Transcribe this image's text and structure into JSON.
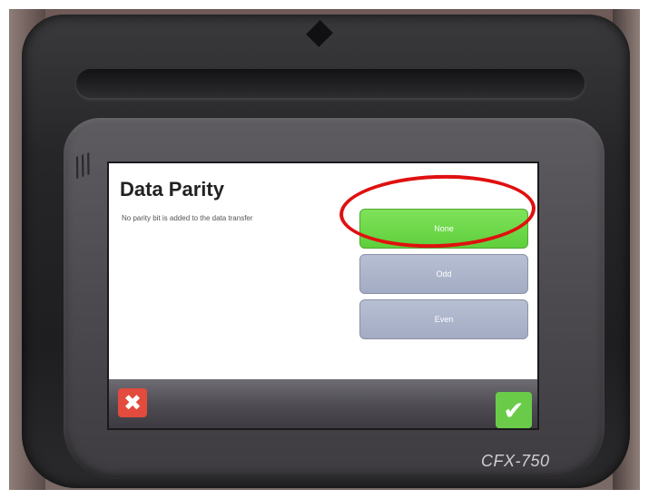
{
  "screen": {
    "title": "Data Parity",
    "description": "No parity bit is added to the data transfer",
    "options": [
      {
        "label": "None",
        "selected": true
      },
      {
        "label": "Odd",
        "selected": false
      },
      {
        "label": "Even",
        "selected": false
      }
    ]
  },
  "toolbar": {
    "cancel_icon": "close-icon",
    "confirm_icon": "checkmark-icon"
  },
  "device": {
    "model": "CFX-750"
  },
  "annotation": {
    "highlight_color": "#e01010",
    "highlighted_option": "None"
  },
  "colors": {
    "selected_option": "#6fd84a",
    "unselected_option": "#aeb6ca",
    "cancel_button": "#e24b3d",
    "confirm_button": "#6acb48"
  }
}
